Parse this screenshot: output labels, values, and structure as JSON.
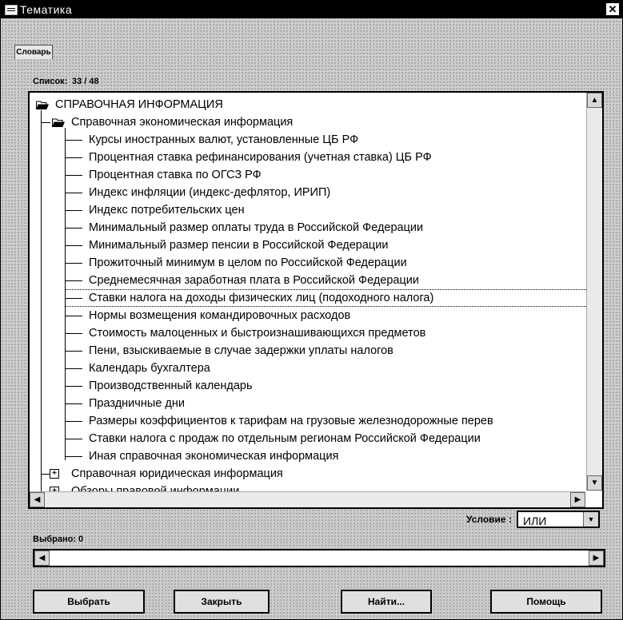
{
  "window": {
    "title": "Тематика",
    "close_glyph": "✕"
  },
  "tabs": {
    "dictionary": "Словарь"
  },
  "list": {
    "label": "Список:",
    "count": "33 / 48"
  },
  "tree": {
    "root": "СПРАВОЧНАЯ ИНФОРМАЦИЯ",
    "group": "Справочная экономическая информация",
    "items": [
      "Курсы иностранных валют, установленные ЦБ РФ",
      "Процентная ставка рефинансирования (учетная ставка) ЦБ РФ",
      "Процентная ставка по ОГСЗ РФ",
      "Индекс инфляции (индекс-дефлятор, ИРИП)",
      "Индекс потребительских цен",
      "Минимальный размер оплаты труда в Российской Федерации",
      "Минимальный размер пенсии в Российской Федерации",
      "Прожиточный минимум в целом по Российской Федерации",
      "Среднемесячная заработная плата в Российской Федерации",
      "Ставки налога на доходы физических лиц (подоходного налога)",
      "Нормы возмещения командировочных расходов",
      "Стоимость малоценных и быстроизнашивающихся предметов",
      "Пени, взыскиваемые в случае задержки уплаты налогов",
      "Календарь бухгалтера",
      "Производственный календарь",
      "Праздничные дни",
      "Размеры коэффициентов к тарифам на грузовые железнодорожные перев",
      "Ставки налога с продаж по отдельным регионам Российской Федерации",
      "Иная справочная экономическая информация"
    ],
    "collapsed": [
      "Справочная юридическая информация",
      "Обзоры правовой информации"
    ]
  },
  "condition": {
    "label": "Условие :",
    "value": "ИЛИ"
  },
  "selected": {
    "label": "Выбрано:",
    "count": "0"
  },
  "buttons": {
    "select": "Выбрать",
    "close": "Закрыть",
    "find": "Найти...",
    "help": "Помощь"
  },
  "colors": {
    "titlebar": "#000000",
    "tree_bg": "#ffffff",
    "window_bg": "#c9c9c9"
  }
}
